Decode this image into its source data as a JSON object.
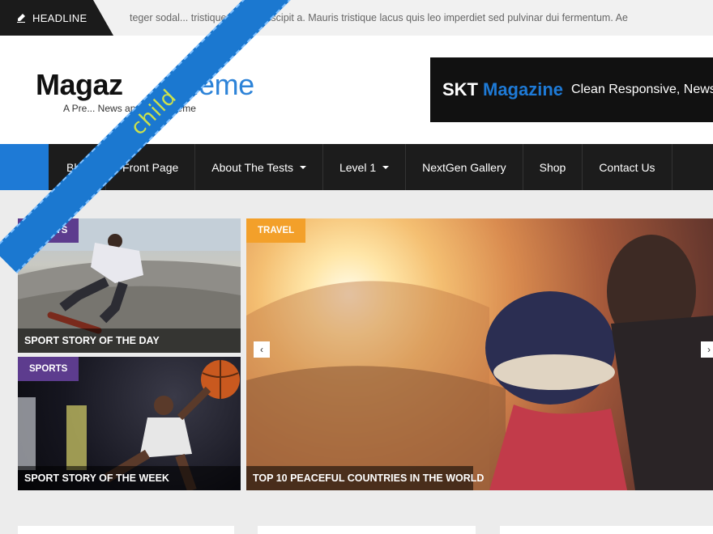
{
  "ticker": {
    "label": "HEADLINE",
    "icon": "pen-icon",
    "text": "teger sodal... tristique neque suscipit a. Mauris tristique lacus quis leo imperdiet sed pulvinar dui fermentum. Ae"
  },
  "header": {
    "logo_bold": "Magaz",
    "logo_light": "heme",
    "tagline": "A Pre... News and Blog Theme"
  },
  "ad": {
    "skt": "SKT",
    "magazine": "Magazine",
    "description": "Clean Responsive, News"
  },
  "nav": {
    "items": [
      {
        "label": "Blog",
        "caret": false
      },
      {
        "label": "Front Page",
        "caret": false
      },
      {
        "label": "About The Tests",
        "caret": true
      },
      {
        "label": "Level 1",
        "caret": true
      },
      {
        "label": "NextGen Gallery",
        "caret": false
      },
      {
        "label": "Shop",
        "caret": false
      },
      {
        "label": "Contact Us",
        "caret": false
      }
    ]
  },
  "tiles": [
    {
      "category": "SPORTS",
      "caption": "SPORT STORY OF THE DAY"
    },
    {
      "category": "SPORTS",
      "caption": "SPORT STORY OF THE WEEK"
    },
    {
      "category": "TRAVEL",
      "caption": "TOP 10 PEACEFUL COUNTRIES IN THE WORLD"
    }
  ],
  "slider": {
    "prev_icon": "chevron-left-icon",
    "next_icon": "chevron-right-icon",
    "prev_glyph": "‹",
    "next_glyph": "›"
  },
  "ribbon": {
    "text": "child"
  },
  "colors": {
    "accent": "#1e7ad6",
    "sports": "#5d3c8e",
    "travel": "#f3a02a",
    "nav_bg": "#1c1c1c",
    "ribbon": "#1b78d0"
  }
}
